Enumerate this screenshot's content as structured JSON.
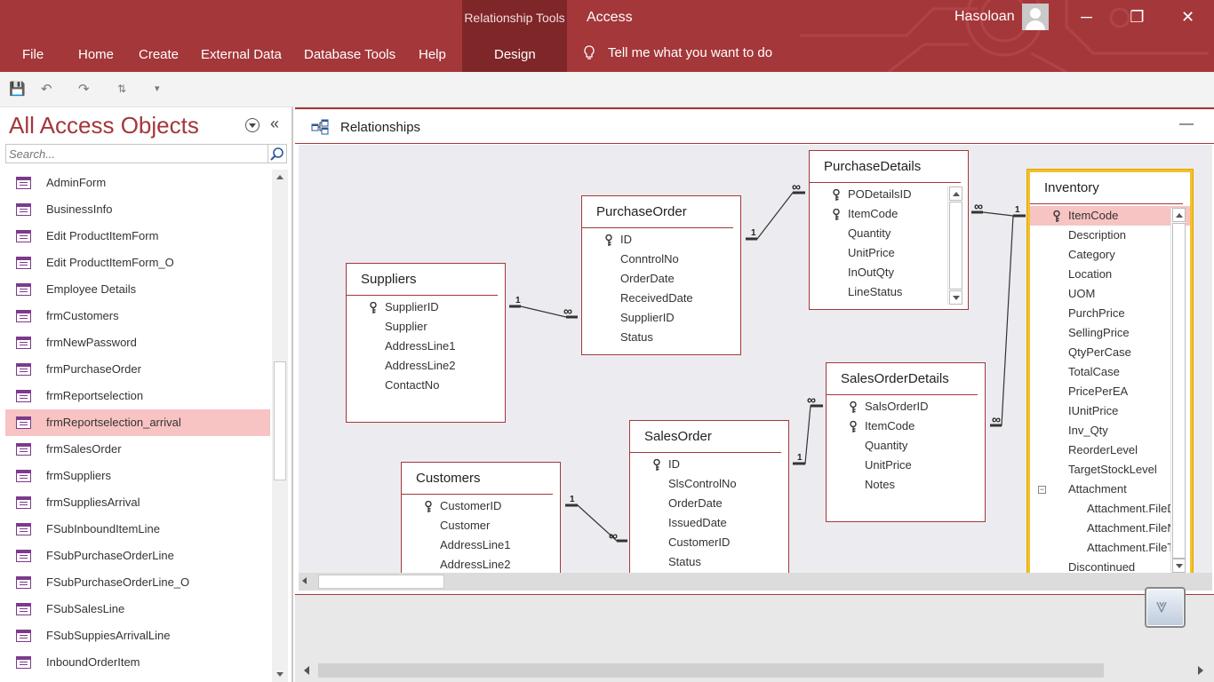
{
  "titlebar": {
    "context_group": "Relationship Tools",
    "app": "Access",
    "user": "Hasoloan",
    "minimize": "─",
    "restore": "❐",
    "close": "✕"
  },
  "ribbon": {
    "tabs": [
      "File",
      "Home",
      "Create",
      "External Data",
      "Database Tools",
      "Help",
      "Design"
    ],
    "tell_me": "Tell me what you want to do"
  },
  "qat": {
    "save": "💾",
    "undo": "↶",
    "redo": "↷",
    "more": "▾"
  },
  "nav": {
    "title": "All Access Objects",
    "collapse": "«",
    "search_placeholder": "Search...",
    "items": [
      "AdminForm",
      "BusinessInfo",
      "Edit ProductItemForm",
      "Edit ProductItemForm_O",
      "Employee Details",
      "frmCustomers",
      "frmNewPassword",
      "frmPurchaseOrder",
      "frmReportselection",
      "frmReportselection_arrival",
      "frmSalesOrder",
      "frmSuppliers",
      "frmSuppliesArrival",
      "FSubInboundItemLine",
      "FSubPurchaseOrderLine",
      "FSubPurchaseOrderLine_O",
      "FSubSalesLine",
      "FSubSuppiesArrivalLine",
      "InboundOrderItem"
    ],
    "selected_index": 9
  },
  "relwin": {
    "title": "Relationships",
    "minimize": "—"
  },
  "tables": {
    "suppliers": {
      "name": "Suppliers",
      "fields": [
        "SupplierID",
        "Supplier",
        "AddressLine1",
        "AddressLine2",
        "ContactNo"
      ]
    },
    "purchaseorder": {
      "name": "PurchaseOrder",
      "fields": [
        "ID",
        "ConntrolNo",
        "OrderDate",
        "ReceivedDate",
        "SupplierID",
        "Status"
      ]
    },
    "purchasedetails": {
      "name": "PurchaseDetails",
      "fields": [
        "PODetailsID",
        "ItemCode",
        "Quantity",
        "UnitPrice",
        "InOutQty",
        "LineStatus"
      ]
    },
    "salesorderdetails": {
      "name": "SalesOrderDetails",
      "fields": [
        "SalsOrderID",
        "ItemCode",
        "Quantity",
        "UnitPrice",
        "Notes"
      ]
    },
    "salesorder": {
      "name": "SalesOrder",
      "fields": [
        "ID",
        "SlsControlNo",
        "OrderDate",
        "IssuedDate",
        "CustomerID",
        "Status"
      ]
    },
    "customers": {
      "name": "Customers",
      "fields": [
        "CustomerID",
        "Customer",
        "AddressLine1",
        "AddressLine2"
      ]
    },
    "inventory": {
      "name": "Inventory",
      "fields": [
        "ItemCode",
        "Description",
        "Category",
        "Location",
        "UOM",
        "PurchPrice",
        "SellingPrice",
        "QtyPerCase",
        "TotalCase",
        "PricePerEA",
        "IUnitPrice",
        "Inv_Qty",
        "ReorderLevel",
        "TargetStockLevel",
        "Attachment",
        "Attachment.FileD",
        "Attachment.FileN",
        "Attachment.FileT",
        "Discontinued"
      ]
    }
  },
  "relationship_labels": {
    "one": "1",
    "many": "∞"
  },
  "colors": {
    "accent": "#a4373a",
    "selected": "#f8c3c3",
    "active_border": "#f4c02a"
  }
}
